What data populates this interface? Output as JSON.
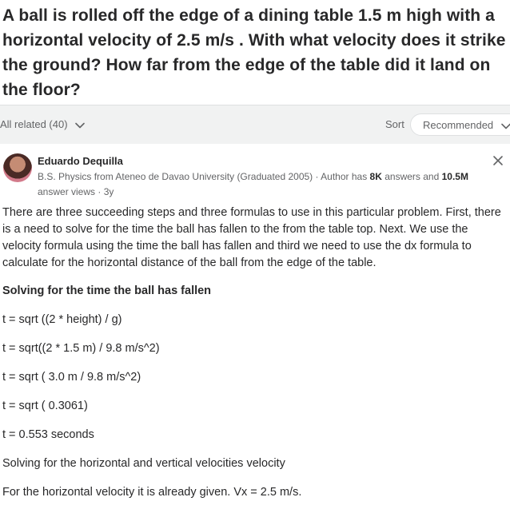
{
  "question": {
    "title": "A ball is rolled off the edge of a dining table 1.5 m high with a horizontal velocity of 2.5 m/s . With what velocity does it strike the ground? How far from the edge of the table did it land on the floor?"
  },
  "filter_bar": {
    "all_related_label": "All related (40)",
    "sort_label": "Sort",
    "sort_value": "Recommended"
  },
  "answer": {
    "author_name": "Eduardo Dequilla",
    "credential_prefix": "B.S. Physics from Ateneo de Davao University (Graduated 2005) · Author has ",
    "answers_count": "8K",
    "credential_mid": " answers and ",
    "views_count": "10.5M",
    "credential_suffix": " answer views · 3y",
    "paragraphs": {
      "intro": "There are three succeeding steps and three formulas to use in this particular problem. First, there is a need to solve for the time the ball has fallen to the from the table top. Next. We use the velocity formula using the time the ball has fallen and third we need to use the dx formula to calculate for the horizontal distance of the ball from the edge of the table.",
      "subheading": "Solving for the time the ball has fallen",
      "eq1": "t = sqrt ((2 * height) / g)",
      "eq2": "t = sqrt((2 * 1.5 m) / 9.8 m/s^2)",
      "eq3": "t = sqrt ( 3.0 m / 9.8 m/s^2)",
      "eq4": "t = sqrt ( 0.3061)",
      "eq5": "t = 0.553 seconds",
      "line6": "Solving for the horizontal and vertical velocities velocity",
      "line7": "For the horizontal velocity it is already given. Vx = 2.5 m/s."
    }
  },
  "colors": {
    "text_primary": "#282829",
    "text_secondary": "#636466",
    "filter_bg": "#f1f2f2",
    "border": "#dee0e1"
  },
  "icons": [
    "chevron-down-icon",
    "close-icon",
    "avatar"
  ]
}
